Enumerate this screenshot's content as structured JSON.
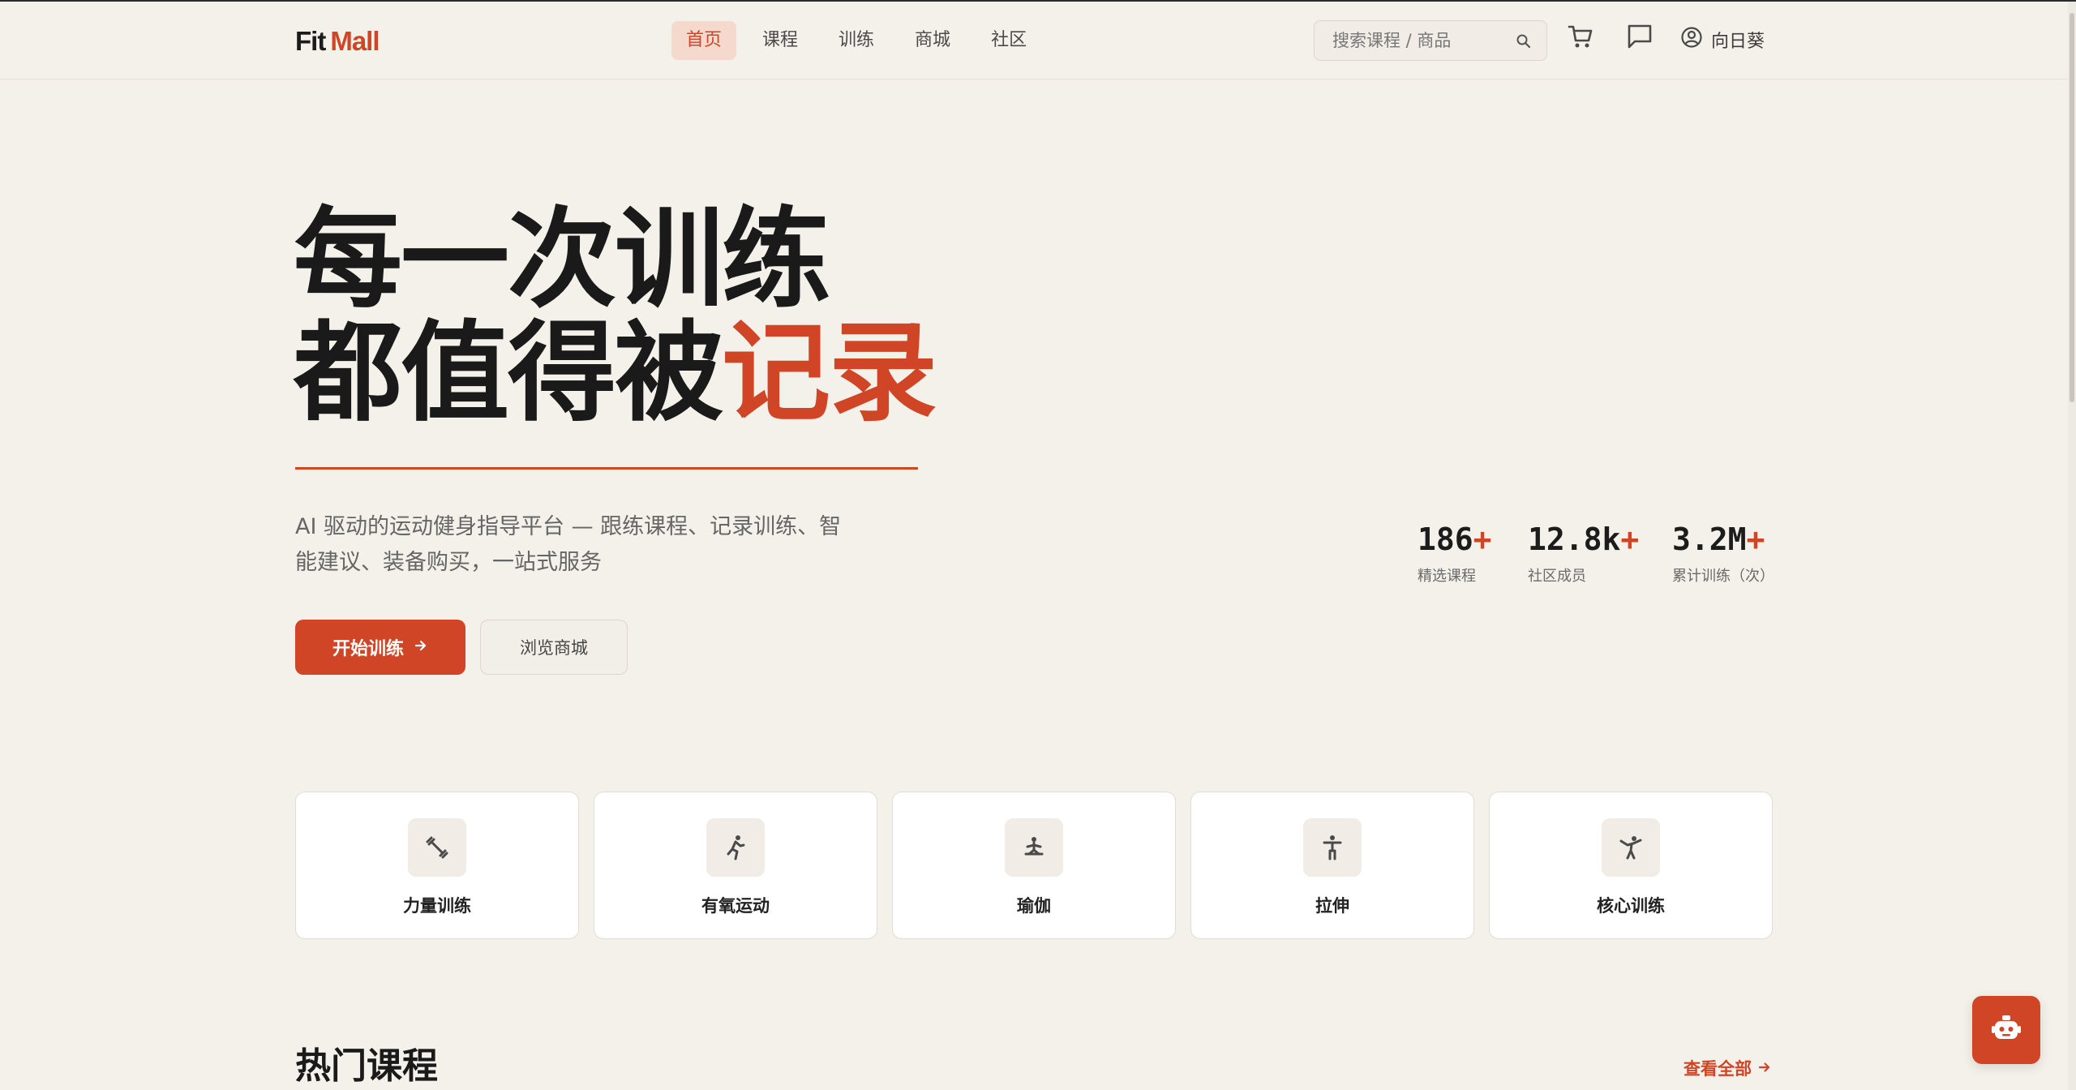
{
  "header": {
    "logo": {
      "part1": "Fit",
      "part2": "Mall"
    },
    "nav": [
      {
        "label": "首页",
        "active": true
      },
      {
        "label": "课程",
        "active": false
      },
      {
        "label": "训练",
        "active": false
      },
      {
        "label": "商城",
        "active": false
      },
      {
        "label": "社区",
        "active": false
      }
    ],
    "search": {
      "placeholder": "搜索课程 / 商品",
      "value": ""
    },
    "icons": [
      "cart-icon",
      "message-icon"
    ],
    "user": {
      "name": "向日葵"
    }
  },
  "hero": {
    "title_line1": "每一次训练",
    "title_line2_plain": "都值得被",
    "title_line2_accent": "记录",
    "subtitle": "AI 驱动的运动健身指导平台 — 跟练课程、记录训练、智能建议、装备购买，一站式服务",
    "primary_button": "开始训练",
    "secondary_button": "浏览商城"
  },
  "stats": [
    {
      "value": "186",
      "suffix": "+",
      "label": "精选课程"
    },
    {
      "value": "12.8k",
      "suffix": "+",
      "label": "社区成员"
    },
    {
      "value": "3.2M",
      "suffix": "+",
      "label": "累计训练（次）"
    }
  ],
  "categories": [
    {
      "label": "力量训练",
      "icon": "dumbbell-icon"
    },
    {
      "label": "有氧运动",
      "icon": "running-icon"
    },
    {
      "label": "瑜伽",
      "icon": "yoga-icon"
    },
    {
      "label": "拉伸",
      "icon": "stretch-icon"
    },
    {
      "label": "核心训练",
      "icon": "martial-arts-icon"
    }
  ],
  "section": {
    "title": "热门课程",
    "view_all": "查看全部"
  },
  "colors": {
    "accent": "#cf4525",
    "background": "#f4f0ea",
    "card": "#ffffff"
  }
}
